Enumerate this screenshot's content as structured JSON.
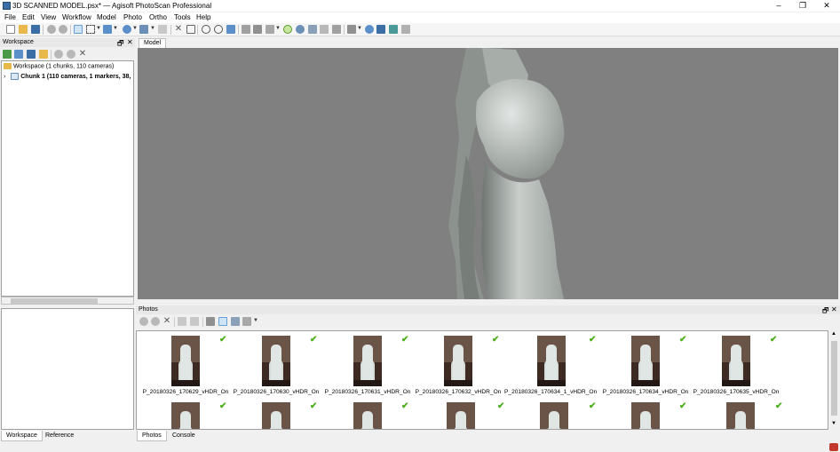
{
  "window": {
    "title": "3D SCANNED MODEL.psx* — Agisoft PhotoScan Professional",
    "minimize": "–",
    "restore": "❐",
    "close": "✕"
  },
  "menu": [
    "File",
    "Edit",
    "View",
    "Workflow",
    "Model",
    "Photo",
    "Ortho",
    "Tools",
    "Help"
  ],
  "workspace": {
    "title": "Workspace",
    "pin": "🗗",
    "close": "✕",
    "root_label": "Workspace (1 chunks, 110 cameras)",
    "chunk_label": "Chunk 1 (110 cameras, 1 markers, 38,",
    "chunk_expander": "›",
    "tabs": [
      "Workspace",
      "Reference"
    ]
  },
  "model": {
    "tab": "Model"
  },
  "photos": {
    "title": "Photos",
    "tabs": [
      "Photos",
      "Console"
    ],
    "items": [
      {
        "label": "P_20180326_170629_vHDR_On",
        "aligned": true
      },
      {
        "label": "P_20180326_170630_vHDR_On",
        "aligned": true
      },
      {
        "label": "P_20180326_170631_vHDR_On",
        "aligned": true
      },
      {
        "label": "P_20180326_170632_vHDR_On",
        "aligned": true
      },
      {
        "label": "P_20180326_170634_1_vHDR_On",
        "aligned": true
      },
      {
        "label": "P_20180326_170634_vHDR_On",
        "aligned": true
      },
      {
        "label": "P_20180326_170635_vHDR_On",
        "aligned": true
      }
    ],
    "check_glyph": "✔",
    "scroll_up": "▲",
    "scroll_down": "▼"
  },
  "colors": {
    "accent": "#3a6ea5",
    "check": "#4caf1a",
    "viewport_bg": "#808080"
  }
}
